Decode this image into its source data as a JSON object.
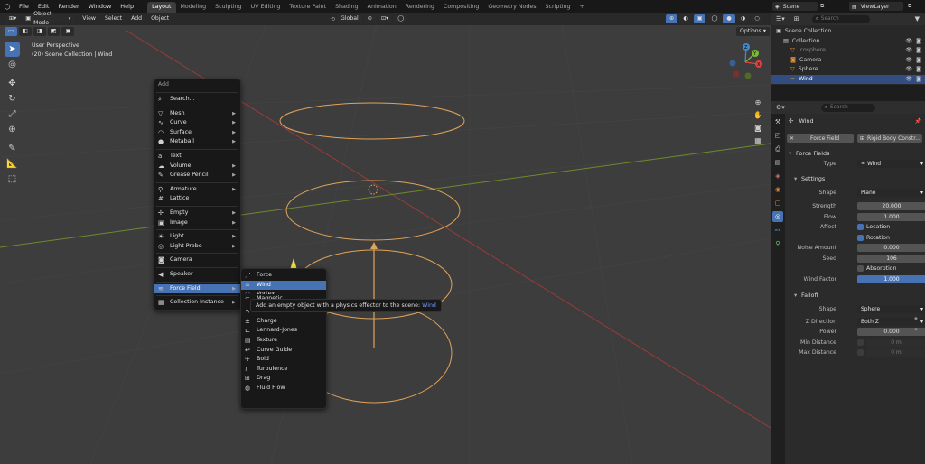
{
  "topbar": {
    "menus": [
      "File",
      "Edit",
      "Render",
      "Window",
      "Help"
    ],
    "workspaces": [
      "Layout",
      "Modeling",
      "Sculpting",
      "UV Editing",
      "Texture Paint",
      "Shading",
      "Animation",
      "Rendering",
      "Compositing",
      "Geometry Nodes",
      "Scripting"
    ],
    "add_tab": "+",
    "scene": "Scene",
    "view_layer": "ViewLayer"
  },
  "viewport": {
    "mode": "Object Mode",
    "menus": [
      "View",
      "Select",
      "Add",
      "Object"
    ],
    "transform": "Global",
    "perspective": "User Perspective",
    "collection_info": "(20) Scene Collection | Wind",
    "options": "Options"
  },
  "gizmo": {
    "x": "X",
    "y": "Y",
    "z": "Z"
  },
  "add_menu": {
    "title": "Add",
    "search": "Search...",
    "items": [
      {
        "label": "Mesh",
        "icon": "▽",
        "sub": true
      },
      {
        "label": "Curve",
        "icon": "∿",
        "sub": true
      },
      {
        "label": "Surface",
        "icon": "◠",
        "sub": true
      },
      {
        "label": "Metaball",
        "icon": "●",
        "sub": true
      },
      {
        "label": "Text",
        "icon": "a",
        "sub": false
      },
      {
        "label": "Volume",
        "icon": "☁",
        "sub": true
      },
      {
        "label": "Grease Pencil",
        "icon": "✎",
        "sub": true
      },
      {
        "label": "Armature",
        "icon": "⚲",
        "sub": true
      },
      {
        "label": "Lattice",
        "icon": "#",
        "sub": false
      },
      {
        "label": "Empty",
        "icon": "✢",
        "sub": true
      },
      {
        "label": "Image",
        "icon": "▣",
        "sub": true
      },
      {
        "label": "Light",
        "icon": "☀",
        "sub": true
      },
      {
        "label": "Light Probe",
        "icon": "◎",
        "sub": true
      },
      {
        "label": "Camera",
        "icon": "◙",
        "sub": false
      },
      {
        "label": "Speaker",
        "icon": "◀",
        "sub": false
      },
      {
        "label": "Force Field",
        "icon": "≋",
        "sub": true
      },
      {
        "label": "Collection Instance",
        "icon": "▦",
        "sub": true
      }
    ]
  },
  "force_field_menu": {
    "items": [
      {
        "label": "Force",
        "icon": "⋰"
      },
      {
        "label": "Wind",
        "icon": "≈"
      },
      {
        "label": "Vortex",
        "icon": "◌"
      },
      {
        "label": "Magnetic",
        "icon": "⊂"
      },
      {
        "label": "Harmonic",
        "icon": "∿"
      },
      {
        "label": "Charge",
        "icon": "±"
      },
      {
        "label": "Lennard-Jones",
        "icon": "⊏"
      },
      {
        "label": "Texture",
        "icon": "▤"
      },
      {
        "label": "Curve Guide",
        "icon": "↩"
      },
      {
        "label": "Boid",
        "icon": "✈"
      },
      {
        "label": "Turbulence",
        "icon": "≀"
      },
      {
        "label": "Drag",
        "icon": "⊞"
      },
      {
        "label": "Fluid Flow",
        "icon": "◍"
      }
    ]
  },
  "tooltip": {
    "text": "Add an empty object with a physics effector to the scene:",
    "highlight": "Wind"
  },
  "outliner": {
    "search_placeholder": "Search",
    "rows": [
      {
        "label": "Scene Collection",
        "indent": 0,
        "color": "#cccccc"
      },
      {
        "label": "Collection",
        "indent": 1,
        "color": "#cccccc"
      },
      {
        "label": "Icosphere",
        "indent": 2,
        "color": "#888888"
      },
      {
        "label": "Camera",
        "indent": 2,
        "color": "#cccccc"
      },
      {
        "label": "Sphere",
        "indent": 2,
        "color": "#cccccc"
      },
      {
        "label": "Wind",
        "indent": 2,
        "color": "#ffffff",
        "selected": true
      }
    ]
  },
  "properties": {
    "search_placeholder": "Search",
    "object_name": "Wind",
    "buttons": [
      "Force Field",
      "Rigid Body Constr..."
    ],
    "force_fields_title": "Force Fields",
    "type_label": "Type",
    "type_value": "Wind",
    "settings_title": "Settings",
    "shape_label": "Shape",
    "shape_value": "Plane",
    "strength_label": "Strength",
    "strength_value": "20.000",
    "flow_label": "Flow",
    "flow_value": "1.000",
    "affect_label": "Affect",
    "location_label": "Location",
    "rotation_label": "Rotation",
    "noise_label": "Noise Amount",
    "noise_value": "0.000",
    "seed_label": "Seed",
    "seed_value": "106",
    "absorption_label": "Absorption",
    "wind_factor_label": "Wind Factor",
    "wind_factor_value": "1.000",
    "falloff_title": "Falloff",
    "falloff_shape_label": "Shape",
    "falloff_shape_value": "Sphere",
    "z_direction_label": "Z Direction",
    "z_direction_value": "Both Z",
    "power_label": "Power",
    "power_value": "0.000",
    "min_distance_label": "Min Distance",
    "min_distance_value": "0 m",
    "max_distance_label": "Max Distance",
    "max_distance_value": "0 m"
  },
  "colors": {
    "accent": "#4772b3",
    "ring": "#e0a35a",
    "x_axis": "#9b3b3b",
    "y_axis": "#6e8a2c"
  }
}
